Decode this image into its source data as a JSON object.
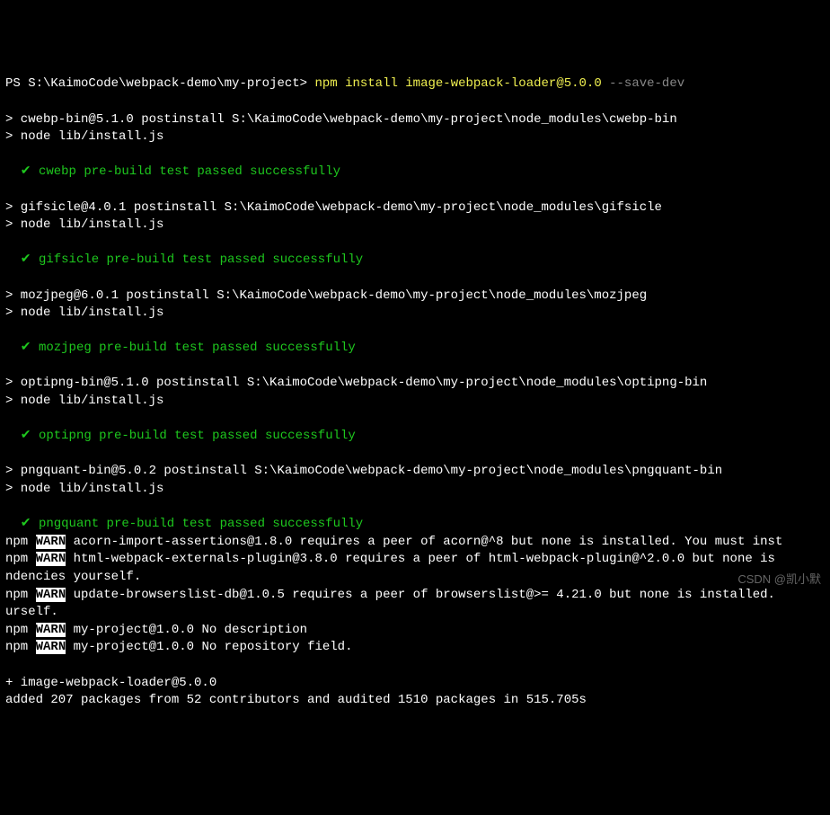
{
  "prompt": "PS S:\\KaimoCode\\webpack-demo\\my-project> ",
  "cmd": "npm install image-webpack-loader@5.0.0 ",
  "flag": "--save-dev",
  "blocks": [
    {
      "postinstall": "> cwebp-bin@5.1.0 postinstall S:\\KaimoCode\\webpack-demo\\my-project\\node_modules\\cwebp-bin",
      "node": "> node lib/install.js",
      "check": "  ✔ ",
      "msg": "cwebp pre-build test passed successfully"
    },
    {
      "postinstall": "> gifsicle@4.0.1 postinstall S:\\KaimoCode\\webpack-demo\\my-project\\node_modules\\gifsicle",
      "node": "> node lib/install.js",
      "check": "  ✔ ",
      "msg": "gifsicle pre-build test passed successfully"
    },
    {
      "postinstall": "> mozjpeg@6.0.1 postinstall S:\\KaimoCode\\webpack-demo\\my-project\\node_modules\\mozjpeg",
      "node": "> node lib/install.js",
      "check": "  ✔ ",
      "msg": "mozjpeg pre-build test passed successfully"
    },
    {
      "postinstall": "> optipng-bin@5.1.0 postinstall S:\\KaimoCode\\webpack-demo\\my-project\\node_modules\\optipng-bin",
      "node": "> node lib/install.js",
      "check": "  ✔ ",
      "msg": "optipng pre-build test passed successfully"
    },
    {
      "postinstall": "> pngquant-bin@5.0.2 postinstall S:\\KaimoCode\\webpack-demo\\my-project\\node_modules\\pngquant-bin",
      "node": "> node lib/install.js",
      "check": "  ✔ ",
      "msg": "pngquant pre-build test passed successfully"
    }
  ],
  "warn_label": "WARN",
  "warns": [
    "npm WARN acorn-import-assertions@1.8.0 requires a peer of acorn@^8 but none is installed. You must inst",
    "npm WARN html-webpack-externals-plugin@3.8.0 requires a peer of html-webpack-plugin@^2.0.0 but none is \nndencies yourself.",
    "npm WARN update-browserslist-db@1.0.5 requires a peer of browserslist@>= 4.21.0 but none is installed. \nurself.",
    "npm WARN my-project@1.0.0 No description",
    "npm WARN my-project@1.0.0 No repository field."
  ],
  "footer": {
    "plus": "+ image-webpack-loader@5.0.0",
    "added": "added 207 packages from 52 contributors and audited 1510 packages in 515.705s"
  },
  "watermark": "CSDN @凯小默"
}
